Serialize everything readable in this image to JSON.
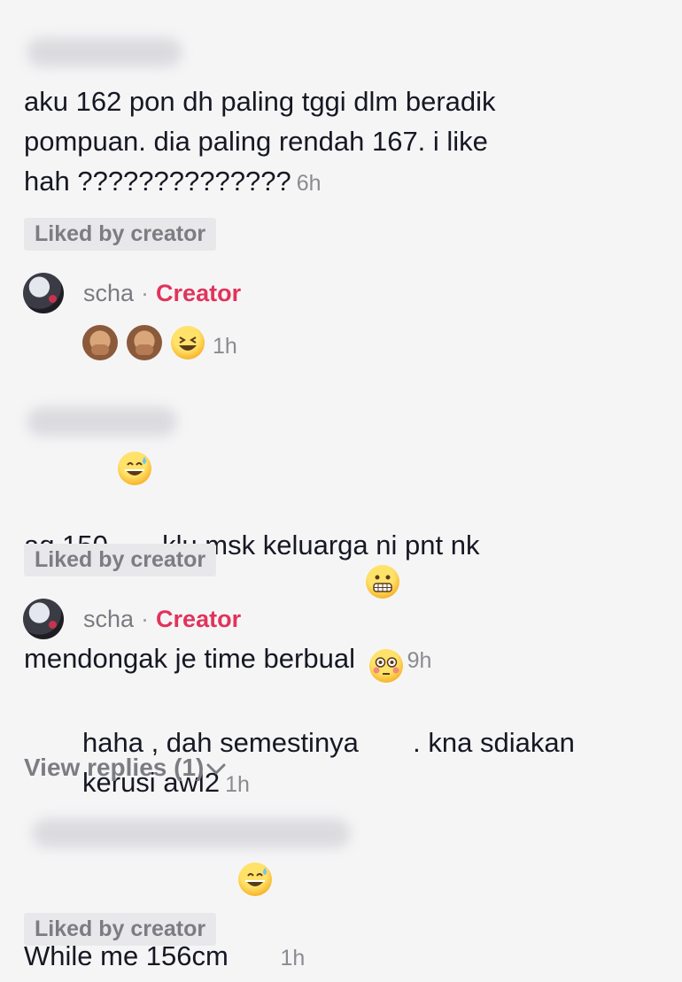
{
  "comments": [
    {
      "text": "aku 162 pon dh paling tggi dlm beradik\npompuan. dia paling rendah 167. i like\nhah ??????????????",
      "time": "6h",
      "liked_label": "Liked by creator",
      "reply": {
        "author": "scha",
        "separator": "·",
        "badge": "Creator",
        "emojis": [
          "see-no-evil-monkey-emoji",
          "see-no-evil-monkey-emoji",
          "grinning-squinting-face-emoji"
        ],
        "time": "1h"
      }
    },
    {
      "text_part1": "aq 150",
      "text_part2": " klu msk keluarga ni pnt nk\nmendongak je time berbual",
      "emojis": [
        "grinning-sweat-emoji",
        "grimacing-face-emoji"
      ],
      "time": "9h",
      "liked_label": "Liked by creator",
      "reply": {
        "author": "scha",
        "separator": "·",
        "badge": "Creator",
        "text_part1": "haha , dah semestinya",
        "text_part2": " . kna sdiakan\nkerusi awl2",
        "emoji": "flushed-face-emoji",
        "time": "1h"
      },
      "view_replies": "View replies (1)"
    },
    {
      "text": "While me 156cm",
      "emoji": "grinning-sweat-emoji",
      "time": "1h",
      "liked_label": "Liked by creator"
    }
  ]
}
